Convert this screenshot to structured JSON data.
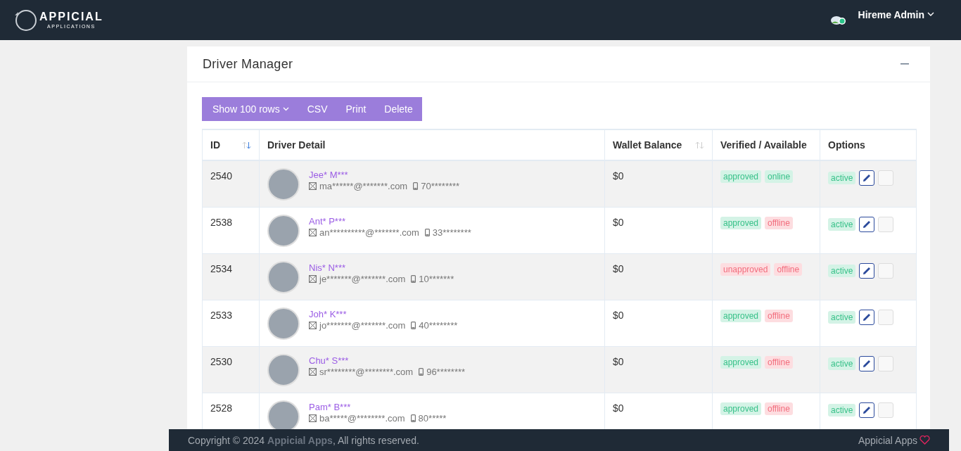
{
  "header": {
    "logo_title": "APPICIAL",
    "logo_subtitle": "APPLICATIONS",
    "user": "Hireme Admin"
  },
  "card": {
    "title": "Driver Manager"
  },
  "toolbar": [
    "Show 100 rows",
    "CSV",
    "Print",
    "Delete"
  ],
  "table": {
    "columns": [
      {
        "label": "ID",
        "sortable": true
      },
      {
        "label": "Driver Detail",
        "sortable": false
      },
      {
        "label": "Wallet Balance",
        "sortable": true
      },
      {
        "label": "Verified / Available",
        "sortable": false
      },
      {
        "label": "Options",
        "sortable": false
      }
    ],
    "rows": [
      {
        "id": "2540",
        "name": "Jee* M***",
        "email": "ma******@*******.com",
        "phone": "70********",
        "wallet": "$0",
        "verified": true,
        "verified_label": "approved",
        "online": true,
        "online_label": "online",
        "active": true,
        "active_label": "active",
        "checked": false
      },
      {
        "id": "2538",
        "name": "Ant* P***",
        "email": "an**********@*******.com",
        "phone": "33********",
        "wallet": "$0",
        "verified": true,
        "verified_label": "approved",
        "online": false,
        "online_label": "offline",
        "active": true,
        "active_label": "active",
        "checked": false
      },
      {
        "id": "2534",
        "name": "Nis* N***",
        "email": "je*******@*******.com",
        "phone": "10*******",
        "wallet": "$0",
        "verified": false,
        "verified_label": "unapproved",
        "online": false,
        "online_label": "offline",
        "active": true,
        "active_label": "active",
        "checked": false
      },
      {
        "id": "2533",
        "name": "Joh* K***",
        "email": "jo*******@*******.com",
        "phone": "40********",
        "wallet": "$0",
        "verified": true,
        "verified_label": "approved",
        "online": false,
        "online_label": "offline",
        "active": true,
        "active_label": "active",
        "checked": false
      },
      {
        "id": "2530",
        "name": "Chu* S***",
        "email": "sr********@********.com",
        "phone": "96********",
        "wallet": "$0",
        "verified": true,
        "verified_label": "approved",
        "online": false,
        "online_label": "offline",
        "active": true,
        "active_label": "active",
        "checked": false
      },
      {
        "id": "2528",
        "name": "Pam* B***",
        "email": "ba*****@********.com",
        "phone": "80*****",
        "wallet": "$0",
        "verified": true,
        "verified_label": "approved",
        "online": false,
        "online_label": "offline",
        "active": true,
        "active_label": "active",
        "checked": false
      }
    ]
  },
  "footer": {
    "copyright_before": "Copyright © 2024 ",
    "copyright_brand": "Appicial Apps",
    "copyright_after": ", All rights reserved.",
    "brand": "Appicial Apps"
  }
}
